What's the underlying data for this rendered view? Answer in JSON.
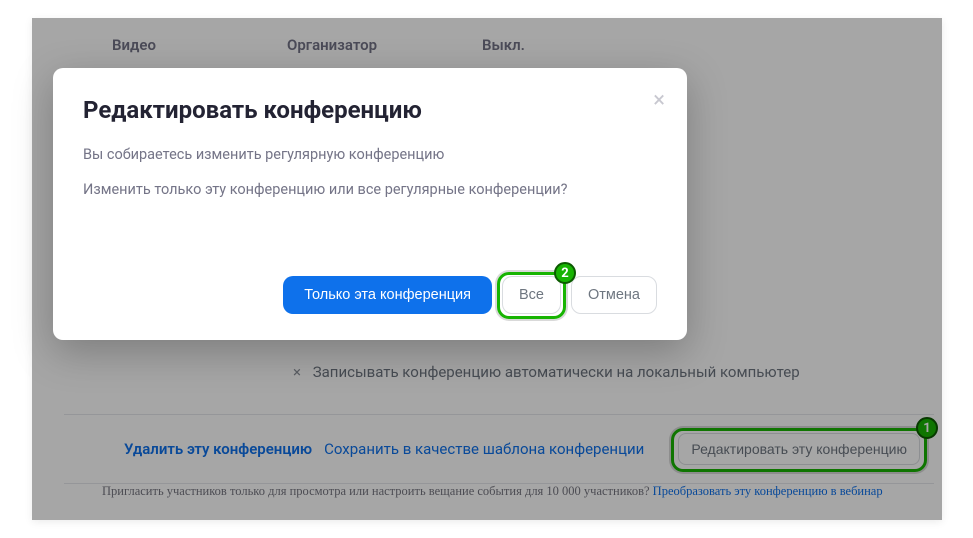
{
  "header": {
    "col1": "Видео",
    "col2": "Организатор",
    "col3": "Выкл."
  },
  "record_row": {
    "icon": "×",
    "text": "Записывать конференцию автоматически на локальный компьютер"
  },
  "action_bar": {
    "delete": "Удалить эту конференцию",
    "save_template": "Сохранить в качестве шаблона конференции",
    "edit": "Редактировать эту конференцию"
  },
  "invite": {
    "text": "Пригласить участников только для просмотра или настроить вещание события для 10 000 участников? ",
    "link": "Преобразовать эту конференцию в вебинар"
  },
  "modal": {
    "title": "Редактировать конференцию",
    "line1": "Вы собираетесь изменить регулярную конференцию",
    "line2": "Изменить только эту конференцию или все регулярные конференции?",
    "btn_only": "Только эта конференция",
    "btn_all": "Все",
    "btn_cancel": "Отмена"
  },
  "callouts": {
    "one": "1",
    "two": "2"
  }
}
